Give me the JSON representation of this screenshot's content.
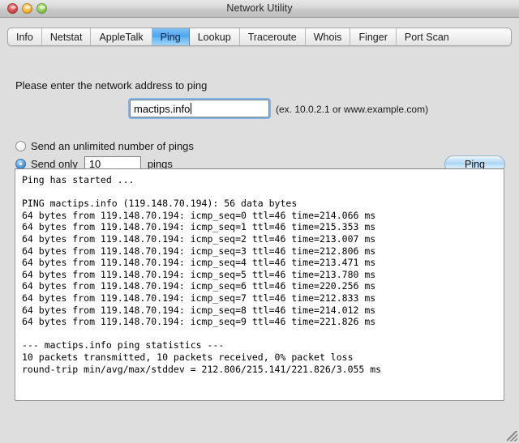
{
  "window": {
    "title": "Network Utility",
    "controls": {
      "close_label": "close",
      "minimize_label": "minimize",
      "zoom_label": "zoom"
    }
  },
  "tabs": [
    {
      "label": "Info",
      "selected": false
    },
    {
      "label": "Netstat",
      "selected": false
    },
    {
      "label": "AppleTalk",
      "selected": false
    },
    {
      "label": "Ping",
      "selected": true
    },
    {
      "label": "Lookup",
      "selected": false
    },
    {
      "label": "Traceroute",
      "selected": false
    },
    {
      "label": "Whois",
      "selected": false
    },
    {
      "label": "Finger",
      "selected": false
    },
    {
      "label": "Port Scan",
      "selected": false
    }
  ],
  "ping_panel": {
    "prompt": "Please enter the network address to ping",
    "address_value": "mactips.info",
    "address_placeholder": "",
    "address_hint": "(ex. 10.0.2.1 or www.example.com)",
    "option_unlimited_label": "Send an unlimited number of pings",
    "option_unlimited_selected": false,
    "option_only_label_before": "Send only",
    "option_only_label_after": "pings",
    "option_only_selected": true,
    "count_value": "10",
    "ping_button_label": "Ping"
  },
  "output": {
    "text": "Ping has started ...\n\nPING mactips.info (119.148.70.194): 56 data bytes\n64 bytes from 119.148.70.194: icmp_seq=0 ttl=46 time=214.066 ms\n64 bytes from 119.148.70.194: icmp_seq=1 ttl=46 time=215.353 ms\n64 bytes from 119.148.70.194: icmp_seq=2 ttl=46 time=213.007 ms\n64 bytes from 119.148.70.194: icmp_seq=3 ttl=46 time=212.806 ms\n64 bytes from 119.148.70.194: icmp_seq=4 ttl=46 time=213.471 ms\n64 bytes from 119.148.70.194: icmp_seq=5 ttl=46 time=213.780 ms\n64 bytes from 119.148.70.194: icmp_seq=6 ttl=46 time=220.256 ms\n64 bytes from 119.148.70.194: icmp_seq=7 ttl=46 time=212.833 ms\n64 bytes from 119.148.70.194: icmp_seq=8 ttl=46 time=214.012 ms\n64 bytes from 119.148.70.194: icmp_seq=9 ttl=46 time=221.826 ms\n\n--- mactips.info ping statistics ---\n10 packets transmitted, 10 packets received, 0% packet loss\nround-trip min/avg/max/stddev = 212.806/215.141/221.826/3.055 ms"
  },
  "colors": {
    "selected_tab_blue": "#4aa3ee",
    "focus_ring_blue": "#6eafeb",
    "window_bg": "#dedede",
    "output_bg": "#ffffff"
  }
}
